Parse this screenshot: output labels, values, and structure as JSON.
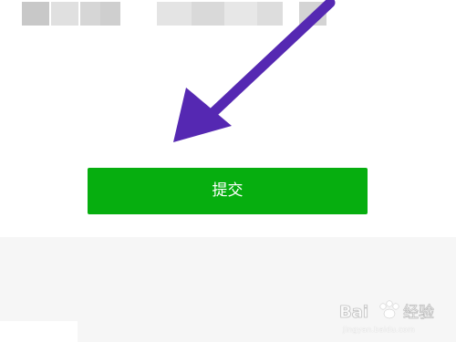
{
  "submit_label": "提交",
  "accent_color": "#06ae0f",
  "annotation_color": "#5528b2",
  "watermark": {
    "text": "Bai 经验",
    "domain": "jingyan.baidu.com"
  }
}
